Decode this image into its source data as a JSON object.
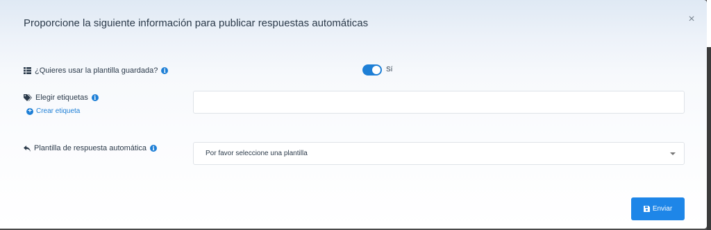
{
  "modal": {
    "title": "Proporcione la siguiente información para publicar respuestas automáticas",
    "close_symbol": "×"
  },
  "template_toggle": {
    "label": "¿Quieres usar la plantilla guardada?",
    "icon": "list-icon",
    "on": true,
    "state_text": "Sí"
  },
  "tags": {
    "label": "Elegir etiquetas",
    "icon": "tags-icon",
    "create_link": "Crear etiqueta",
    "input_value": ""
  },
  "auto_reply": {
    "label": "Plantilla de respuesta automática",
    "icon": "reply-icon",
    "selected": "Por favor seleccione una plantilla"
  },
  "submit": {
    "label": "Enviar",
    "icon": "save-icon"
  },
  "colors": {
    "accent": "#1e7fd6",
    "button": "#1e86e8"
  }
}
